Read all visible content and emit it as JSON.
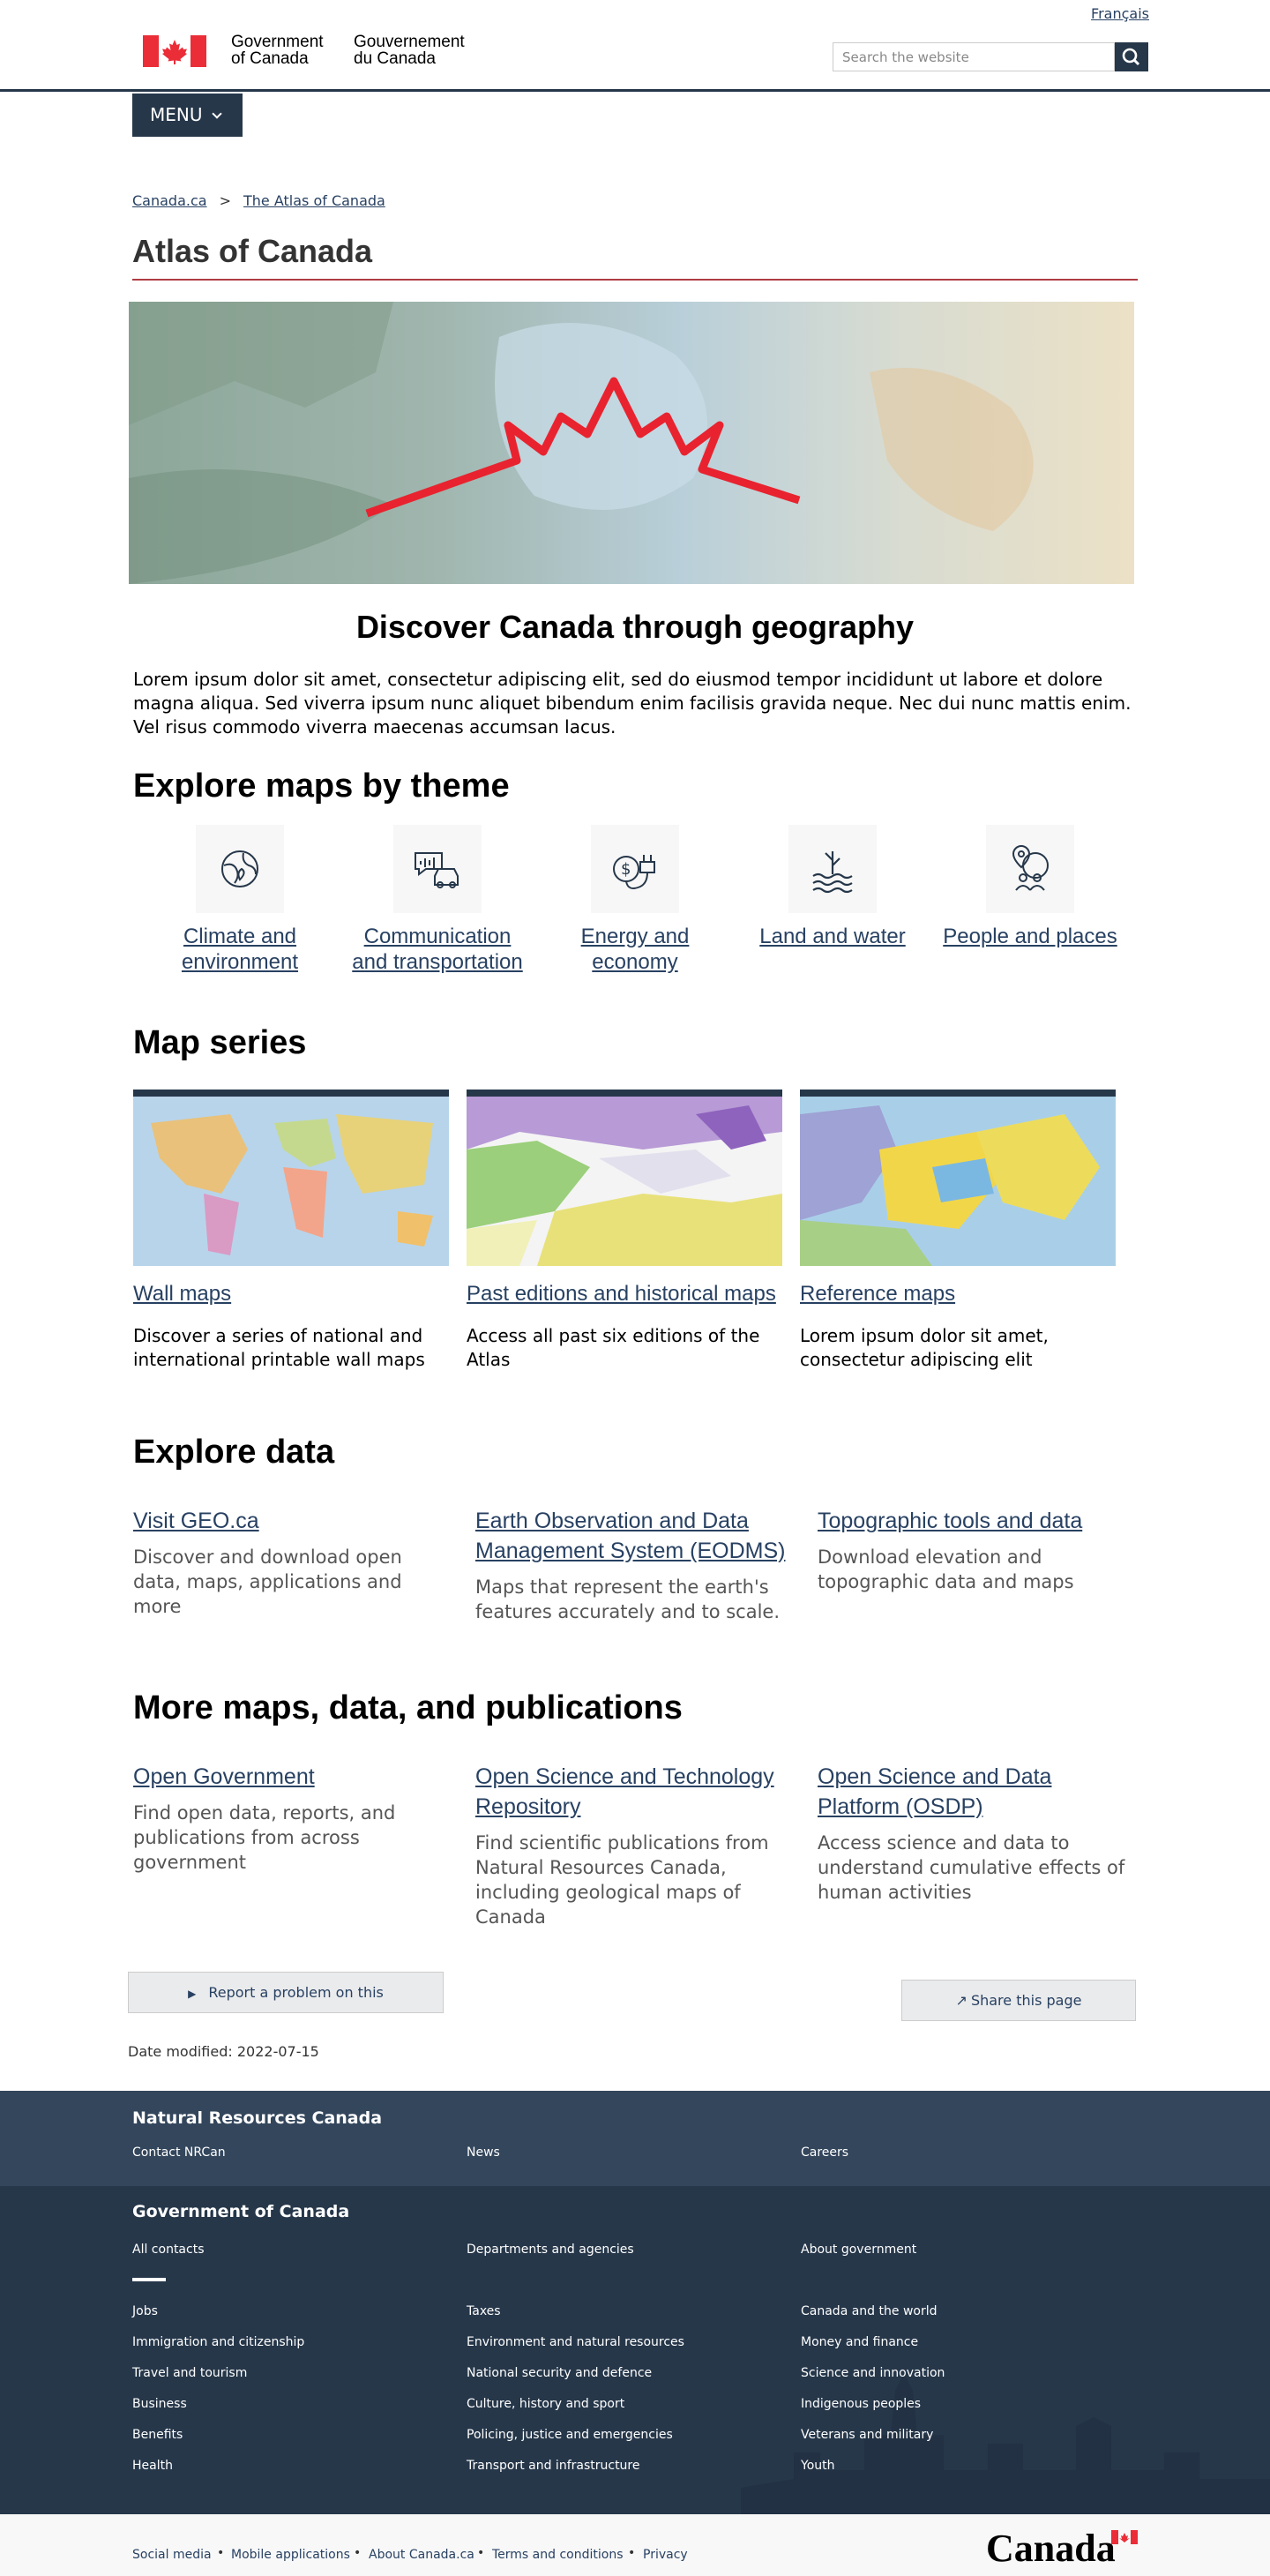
{
  "header": {
    "language_link": "Français",
    "signature_en_line1": "Government",
    "signature_en_line2": "of Canada",
    "signature_fr_line1": "Gouvernement",
    "signature_fr_line2": "du Canada",
    "search_placeholder": "Search the website",
    "search_icon": "search-icon",
    "menu_label": "MENU"
  },
  "breadcrumb": [
    "Canada.ca",
    "The Atlas of Canada"
  ],
  "breadcrumb_separator": ">",
  "page_title": "Atlas of Canada",
  "hero_heading": "Discover Canada through geography",
  "intro": "Lorem ipsum dolor sit amet, consectetur adipiscing elit, sed do eiusmod tempor incididunt ut labore et dolore magna aliqua. Sed viverra ipsum nunc aliquet bibendum enim facilisis gravida neque. Nec dui nunc mattis enim. Vel risus commodo viverra maecenas accumsan lacus.",
  "themes": {
    "heading": "Explore maps by theme",
    "items": [
      {
        "label_line1": "Climate and",
        "label_line2": "environment",
        "icon": "globe-leaf-icon"
      },
      {
        "label_line1": "Communication",
        "label_line2": "and transportation",
        "icon": "chat-car-icon"
      },
      {
        "label_line1": "Energy and",
        "label_line2": "economy",
        "icon": "dollar-plug-icon"
      },
      {
        "label_line1": "Land and water",
        "label_line2": "",
        "icon": "land-water-icon"
      },
      {
        "label_line1": "People and places",
        "label_line2": "",
        "icon": "people-globe-icon"
      }
    ]
  },
  "map_series": {
    "heading": "Map series",
    "cards": [
      {
        "title": "Wall maps",
        "description": "Discover a series of national and international printable wall maps"
      },
      {
        "title": "Past editions and historical maps",
        "description": "Access all past six editions of the Atlas"
      },
      {
        "title": "Reference maps",
        "description": "Lorem ipsum dolor sit amet, consectetur adipiscing elit"
      }
    ]
  },
  "explore_data": {
    "heading": "Explore data",
    "items": [
      {
        "title": "Visit GEO.ca",
        "description": "Discover and download open data, maps, applications and more"
      },
      {
        "title": "Earth Observation and Data Management System (EODMS)",
        "description": "Maps that represent the earth's features accurately and to scale."
      },
      {
        "title": "Topographic tools and data",
        "description": "Download elevation and topographic data and maps"
      }
    ]
  },
  "more": {
    "heading": "More maps, data, and publications",
    "items": [
      {
        "title": "Open Government",
        "description": "Find open data, reports, and publications from across government"
      },
      {
        "title": "Open Science and Technology Repository",
        "description": "Find scientific publications from Natural Resources Canada, including geological maps of Canada"
      },
      {
        "title": "Open Science and Data Platform (OSDP)",
        "description": "Access science and data to understand cumulative effects of human activities"
      }
    ]
  },
  "report_button": "Report a problem on this",
  "share_button": "Share this page",
  "date_modified": "Date modified: 2022-07-15",
  "footer_dept": {
    "heading": "Natural Resources Canada",
    "links": [
      "Contact NRCan",
      "News",
      "Careers"
    ]
  },
  "footer_gov": {
    "heading": "Government of Canada",
    "top_links": [
      "All contacts",
      "Departments and agencies",
      "About government"
    ],
    "col1": [
      "Jobs",
      "Immigration and citizenship",
      "Travel and tourism",
      "Business",
      "Benefits",
      "Health"
    ],
    "col2": [
      "Taxes",
      "Environment and natural resources",
      "National security and defence",
      "Culture, history and sport",
      "Policing, justice and emergencies",
      "Transport and infrastructure"
    ],
    "col3": [
      "Canada and the world",
      "Money and finance",
      "Science and innovation",
      "Indigenous peoples",
      "Veterans and military",
      "Youth"
    ]
  },
  "footer_bottom": {
    "links": [
      "Social media",
      "Mobile applications",
      "About Canada.ca",
      "Terms and conditions",
      "Privacy"
    ],
    "wordmark": "Canada"
  },
  "colors": {
    "navy": "#26374a",
    "link": "#284162",
    "red": "#af3c43",
    "flag_red": "#eb2d37"
  }
}
